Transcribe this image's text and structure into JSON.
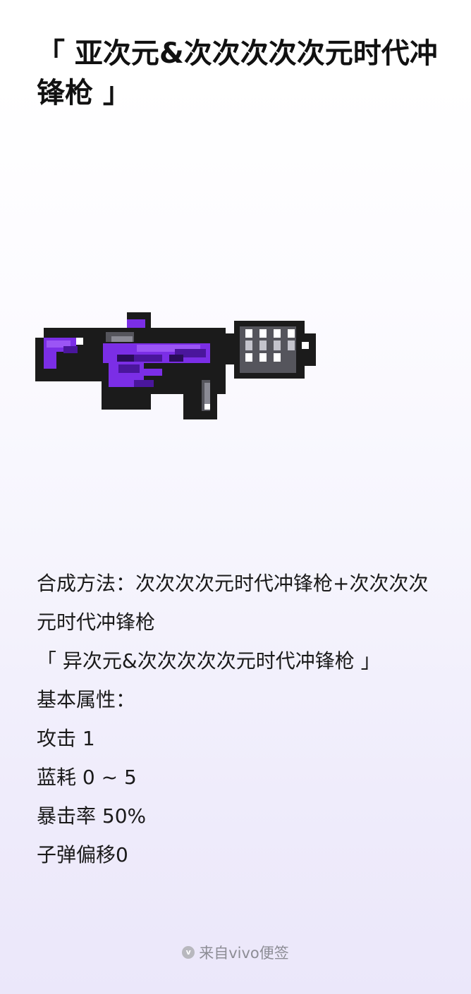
{
  "note": {
    "title": "「 亚次元&次次次次次元时代冲锋枪 」",
    "lines": [
      "合成方法：次次次次元时代冲锋枪+次次次次元时代冲锋枪",
      "「 异次元&次次次次次元时代冲锋枪 」",
      "基本属性：",
      "攻击 1",
      "蓝耗 0 ~ 5",
      "暴击率 50%",
      "子弹偏移0"
    ]
  },
  "image": {
    "icon": "pixel-purple-submachine-gun",
    "accent_color": "#7b2ee6"
  },
  "footer": {
    "icon": "vivo-logo-icon",
    "icon_letter": "v",
    "label": "来自vivo便签"
  }
}
